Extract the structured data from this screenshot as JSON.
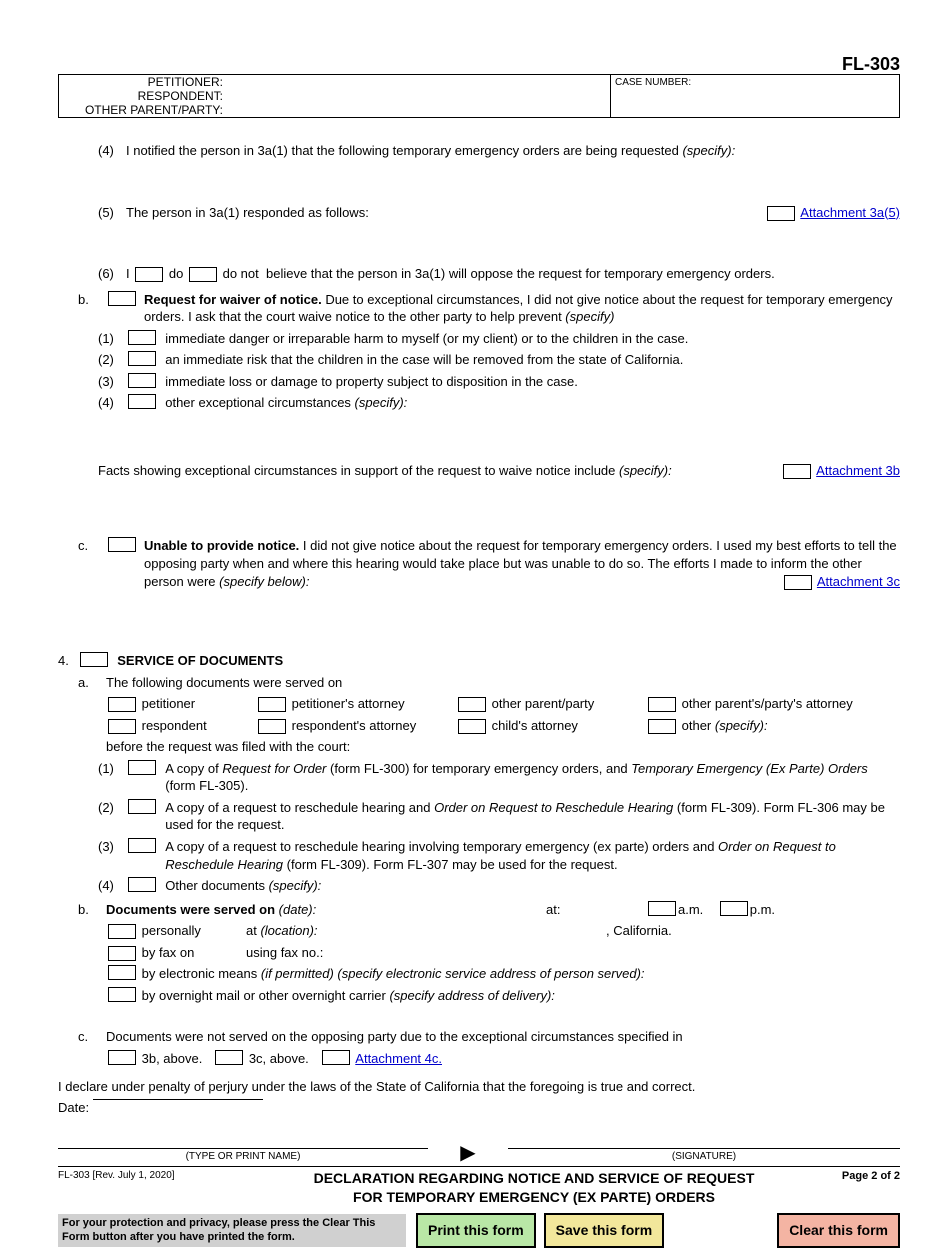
{
  "form_no": "FL-303",
  "header": {
    "petitioner": "PETITIONER:",
    "respondent": "RESPONDENT:",
    "other": "OTHER PARENT/PARTY:",
    "case_no": "CASE NUMBER:"
  },
  "item4": "(4)",
  "item4_text": "I notified the person in 3a(1) that the following temporary emergency orders are being requested",
  "item4_spec": "(specify):",
  "item5": "(5)",
  "item5_text": "The person in 3a(1) responded as follows:",
  "att3a5": "Attachment 3a(5)",
  "item6": "(6)",
  "item6_i": "I",
  "item6_do": "do",
  "item6_donot": "do not",
  "item6_rest": "believe that the person in 3a(1) will oppose the request for temporary emergency orders.",
  "b_label": "b.",
  "b_bold": "Request for waiver of notice.",
  "b_text": " Due to exceptional circumstances, I did not give notice about the request for temporary emergency orders. I ask that the court waive notice to the other party to help prevent ",
  "b_spec": "(specify)",
  "b1": "(1)",
  "b1_text": "immediate danger or irreparable harm to myself (or my client) or to the children in the case.",
  "b2": "(2)",
  "b2_text": "an immediate risk that the children in the case will be removed from the state of California.",
  "b3": "(3)",
  "b3_text": "immediate loss or damage to property subject to disposition in the case.",
  "b4": "(4)",
  "b4_text": "other exceptional circumstances ",
  "b4_spec": "(specify):",
  "b_facts": "Facts showing exceptional circumstances in support of the request to waive notice include ",
  "b_facts_spec": "(specify):",
  "att3b": "Attachment 3b",
  "c_label": "c.",
  "c_bold": "Unable to provide notice.",
  "c_text": " I did not give notice about the request for temporary emergency orders. I used my best efforts to tell the opposing party when and where this hearing would take place but was unable to do so. The efforts I made to inform the other person were ",
  "c_spec": "(specify below):",
  "att3c": "Attachment 3c",
  "s4": "4.",
  "s4_title": "SERVICE OF DOCUMENTS",
  "s4a": "a.",
  "s4a_text": "The following documents were served on",
  "sv": {
    "pet": "petitioner",
    "pet_att": "petitioner's attorney",
    "opp": "other parent/party",
    "opp_att": "other parent's/party's attorney",
    "resp": "respondent",
    "resp_att": "respondent's attorney",
    "child_att": "child's attorney",
    "other": "other ",
    "other_spec": "(specify):"
  },
  "s4a_before": "before the request was filed with the court:",
  "s4a1": "(1)",
  "s4a1_a": "A copy of ",
  "s4a1_b": "Request for Order",
  "s4a1_c": " (form FL-300) for temporary emergency orders, and ",
  "s4a1_d": "Temporary Emergency (Ex Parte) Orders",
  "s4a1_e": " (form FL-305).",
  "s4a2": "(2)",
  "s4a2_a": "A copy of a request to reschedule hearing and ",
  "s4a2_b": "Order on Request to Reschedule Hearing",
  "s4a2_c": " (form FL-309). Form FL-306 may be used for the request.",
  "s4a3": "(3)",
  "s4a3_a": "A copy of a request to reschedule hearing involving temporary emergency (ex parte) orders and ",
  "s4a3_b": "Order on Request to Reschedule Hearing",
  "s4a3_c": " (form FL-309). Form FL-307 may be used for the request.",
  "s4a4": "(4)",
  "s4a4_a": "Other documents ",
  "s4a4_spec": "(specify):",
  "s4b": "b.",
  "s4b_bold": "Documents were served on ",
  "s4b_date": "(date):",
  "s4b_at": "at:",
  "s4b_am": "a.m.",
  "s4b_pm": "p.m.",
  "s4b_pers": "personally",
  "s4b_atloc": "at ",
  "s4b_loc": "(location):",
  "s4b_calif": ", California.",
  "s4b_fax": "by fax on",
  "s4b_faxno": "using fax no.:",
  "s4b_elec_a": "by electronic means ",
  "s4b_elec_b": "(if permitted) (specify electronic service address of person served):",
  "s4b_mail_a": "by overnight mail or other overnight carrier ",
  "s4b_mail_b": "(specify address of delivery):",
  "s4c": "c.",
  "s4c_text": "Documents were not served on the opposing party due to the exceptional circumstances specified in",
  "s4c_3b": "3b, above.",
  "s4c_3c": "3c, above.",
  "att4c": "Attachment 4c.",
  "perjury": "I declare under penalty of perjury under the laws of the State of California that the foregoing is true and correct.",
  "date_lbl": "Date:",
  "type_name": "(TYPE OR PRINT NAME)",
  "signature": "(SIGNATURE)",
  "rev": "FL-303 [Rev. July 1, 2020]",
  "title1": "DECLARATION REGARDING NOTICE AND SERVICE OF REQUEST",
  "title2": "FOR TEMPORARY EMERGENCY (EX PARTE) ORDERS",
  "page": "Page 2 of 2",
  "protect": "For your protection and privacy, please press the Clear This Form button after you have printed the form.",
  "btn_print": "Print this form",
  "btn_save": "Save this form",
  "btn_clear": "Clear this form"
}
